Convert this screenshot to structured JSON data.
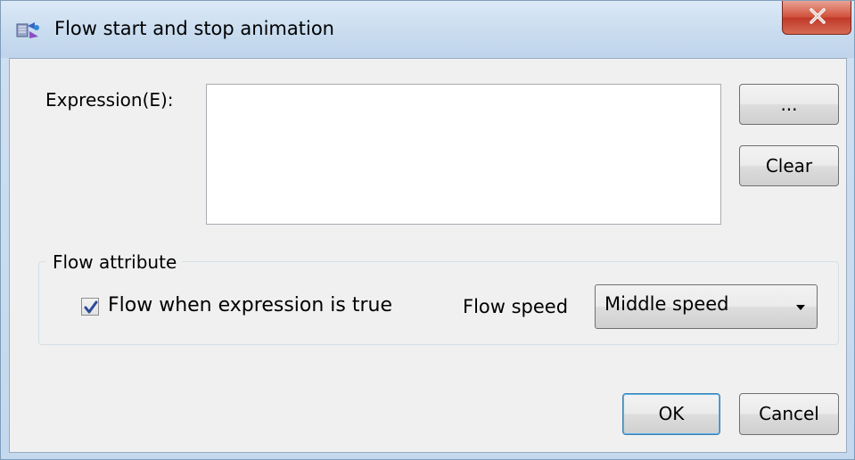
{
  "window": {
    "title": "Flow start and stop animation",
    "icon": "flow-animation-icon",
    "close_icon": "close-icon"
  },
  "expression": {
    "label": "Expression(E):",
    "value": "",
    "browse_label": "...",
    "clear_label": "Clear"
  },
  "flow_attribute": {
    "group_title": "Flow attribute",
    "checkbox_label": "Flow when expression is true",
    "checkbox_checked": true,
    "speed_label": "Flow speed",
    "speed_value": "Middle speed",
    "speed_dropdown_icon": "chevron-down-icon"
  },
  "footer": {
    "ok_label": "OK",
    "cancel_label": "Cancel"
  },
  "colors": {
    "titlebar": "#c9dcef",
    "client_bg": "#f0f0f0",
    "close_button": "#c0392b",
    "checkmark": "#2a4a9a"
  }
}
